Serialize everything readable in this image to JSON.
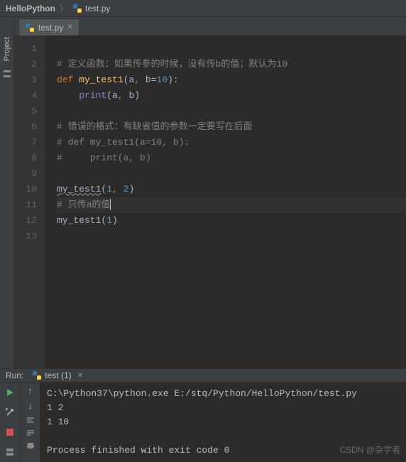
{
  "breadcrumb": {
    "project": "HelloPython",
    "file": "test.py"
  },
  "sidebar": {
    "project_label": "Project"
  },
  "tabs": [
    {
      "label": "test.py"
    }
  ],
  "editor": {
    "lines": [
      {
        "n": 1,
        "tokens": []
      },
      {
        "n": 2,
        "tokens": [
          {
            "c": "c-comment",
            "t": "# 定义函数：如果传参的时候，没有传b的值；默认为10"
          }
        ]
      },
      {
        "n": 3,
        "tokens": [
          {
            "c": "c-keyword",
            "t": "def "
          },
          {
            "c": "c-func",
            "t": "my_test1"
          },
          {
            "c": "c-plain",
            "t": "(a"
          },
          {
            "c": "c-keyword",
            "t": ", "
          },
          {
            "c": "c-plain",
            "t": "b="
          },
          {
            "c": "c-num",
            "t": "10"
          },
          {
            "c": "c-plain",
            "t": "):"
          }
        ]
      },
      {
        "n": 4,
        "tokens": [
          {
            "c": "c-plain",
            "t": "    "
          },
          {
            "c": "c-builtin",
            "t": "print"
          },
          {
            "c": "c-plain",
            "t": "(a"
          },
          {
            "c": "c-keyword",
            "t": ", "
          },
          {
            "c": "c-plain",
            "t": "b)"
          }
        ]
      },
      {
        "n": 5,
        "tokens": []
      },
      {
        "n": 6,
        "tokens": [
          {
            "c": "c-comment",
            "t": "# 错误的格式：有缺省值的参数一定要写在后面"
          }
        ]
      },
      {
        "n": 7,
        "tokens": [
          {
            "c": "c-comment",
            "t": "# def my_test1(a=10, b):"
          }
        ]
      },
      {
        "n": 8,
        "tokens": [
          {
            "c": "c-comment",
            "t": "#     print(a, b)"
          }
        ]
      },
      {
        "n": 9,
        "tokens": []
      },
      {
        "n": 10,
        "tokens": [
          {
            "c": "c-plain warn",
            "t": "my_test1"
          },
          {
            "c": "c-plain",
            "t": "("
          },
          {
            "c": "c-num",
            "t": "1"
          },
          {
            "c": "c-keyword",
            "t": ", "
          },
          {
            "c": "c-num",
            "t": "2"
          },
          {
            "c": "c-plain",
            "t": ")"
          }
        ]
      },
      {
        "n": 11,
        "current": true,
        "tokens": [
          {
            "c": "c-comment",
            "t": "# 只传a的值"
          }
        ],
        "cursor": true
      },
      {
        "n": 12,
        "tokens": [
          {
            "c": "c-plain",
            "t": "my_test1("
          },
          {
            "c": "c-num",
            "t": "1"
          },
          {
            "c": "c-plain",
            "t": ")"
          }
        ]
      },
      {
        "n": 13,
        "tokens": []
      }
    ]
  },
  "run": {
    "label": "Run:",
    "tab_name": "test (1)",
    "output": [
      "C:\\Python37\\python.exe E:/stq/Python/HelloPython/test.py",
      "1 2",
      "1 10",
      "",
      "Process finished with exit code 0"
    ]
  },
  "watermark": "CSDN @杂学者"
}
